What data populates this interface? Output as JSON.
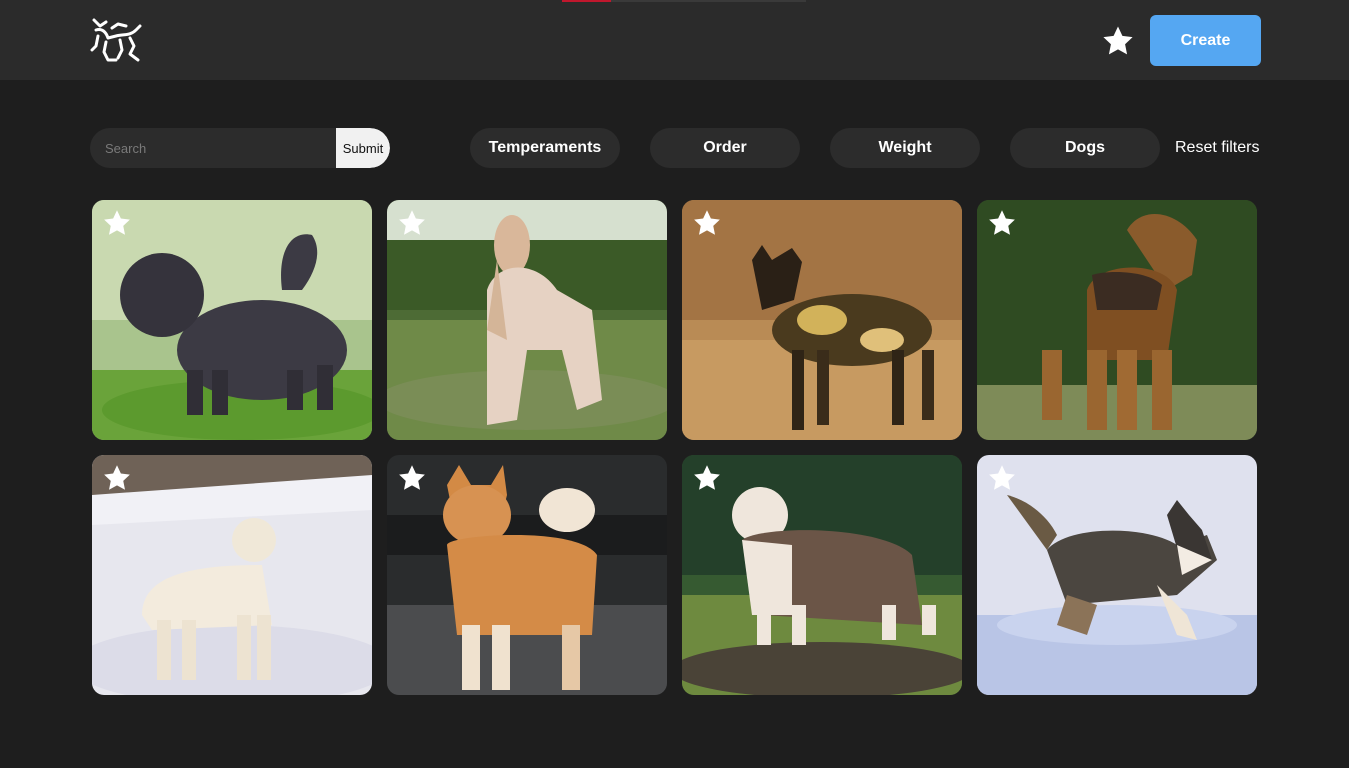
{
  "header": {
    "logo_icon": "animal-logo-icon",
    "favorites_icon": "star-icon",
    "create_label": "Create",
    "loading_progress": 0.2,
    "accent_color": "#55a7f2",
    "loader_color": "#c0172d"
  },
  "search": {
    "placeholder": "Search",
    "value": "",
    "submit_label": "Submit"
  },
  "filters": {
    "temperaments_label": "Temperaments",
    "order_label": "Order",
    "weight_label": "Weight",
    "dogs_label": "Dogs",
    "reset_label": "Reset filters"
  },
  "cards": [
    {
      "image": "affenpinscher-photo",
      "favorite_icon": "star-icon"
    },
    {
      "image": "afghan-hound-photo",
      "favorite_icon": "star-icon"
    },
    {
      "image": "african-hunting-dog-photo",
      "favorite_icon": "star-icon"
    },
    {
      "image": "airedale-terrier-photo",
      "favorite_icon": "star-icon"
    },
    {
      "image": "akbash-dog-photo",
      "favorite_icon": "star-icon"
    },
    {
      "image": "akita-photo",
      "favorite_icon": "star-icon"
    },
    {
      "image": "alapaha-bulldog-photo",
      "favorite_icon": "star-icon"
    },
    {
      "image": "alaskan-husky-photo",
      "favorite_icon": "star-icon"
    }
  ]
}
